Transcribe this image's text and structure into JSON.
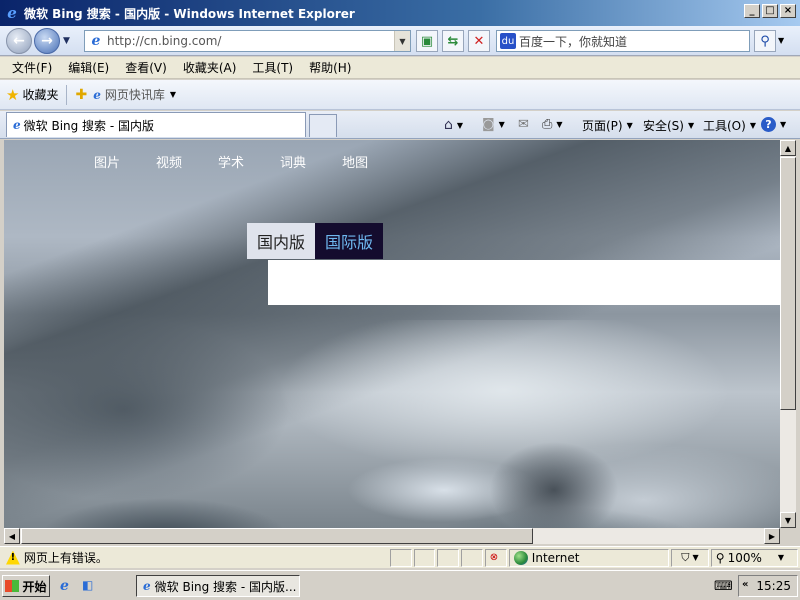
{
  "window": {
    "title": "微软 Bing 搜索 - 国内版 - Windows Internet Explorer"
  },
  "nav": {
    "address": "http://cn.bing.com/",
    "search_placeholder": "百度一下，你就知道"
  },
  "menu": {
    "items": [
      "文件(F)",
      "编辑(E)",
      "查看(V)",
      "收藏夹(A)",
      "工具(T)",
      "帮助(H)"
    ]
  },
  "favorites": {
    "label": "收藏夹",
    "quick_tabs": "网页快讯库"
  },
  "tab": {
    "title": "微软 Bing 搜索 - 国内版"
  },
  "commands": {
    "page": "页面(P)",
    "safety": "安全(S)",
    "tools": "工具(O)"
  },
  "bing": {
    "nav": [
      "图片",
      "视频",
      "学术",
      "词典",
      "地图"
    ],
    "lang_cn": "国内版",
    "lang_intl": "国际版",
    "accent_color": "#6fb8f0",
    "intl_bg": "#140c2e"
  },
  "status": {
    "message": "网页上有错误。",
    "zone": "Internet",
    "zoom": "100%"
  },
  "taskbar": {
    "start": "开始",
    "task": "微软 Bing 搜索 - 国内版...",
    "clock": "15:25"
  }
}
